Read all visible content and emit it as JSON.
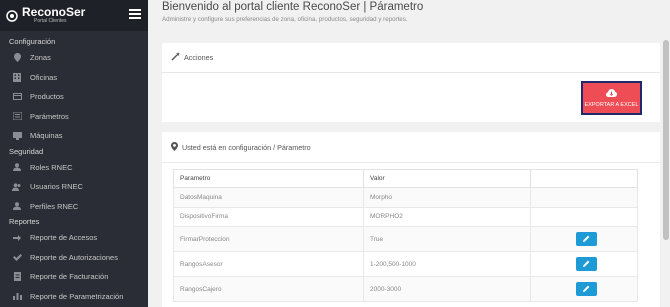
{
  "brand": {
    "name": "ReconoSer",
    "sub": "Portal Clientes"
  },
  "sidebar": {
    "sections": [
      {
        "title": "Configuración",
        "items": [
          {
            "label": "Zonas",
            "icon": "map-marker-icon"
          },
          {
            "label": "Oficinas",
            "icon": "building-icon"
          },
          {
            "label": "Productos",
            "icon": "box-icon"
          },
          {
            "label": "Parámetros",
            "icon": "list-icon"
          },
          {
            "label": "Máquinas",
            "icon": "monitor-icon"
          }
        ]
      },
      {
        "title": "Seguridad",
        "items": [
          {
            "label": "Roles RNEC",
            "icon": "user-icon"
          },
          {
            "label": "Usuarios RNEC",
            "icon": "users-icon"
          },
          {
            "label": "Perfiles RNEC",
            "icon": "user-icon"
          }
        ]
      },
      {
        "title": "Reportes",
        "items": [
          {
            "label": "Reporte de Accesos",
            "icon": "login-icon"
          },
          {
            "label": "Reporte de Autorizaciones",
            "icon": "check-icon"
          },
          {
            "label": "Reporte de Facturación",
            "icon": "invoice-icon"
          },
          {
            "label": "Reporte de Parametrización",
            "icon": "chart-icon"
          }
        ]
      }
    ]
  },
  "header": {
    "title": "Bienvenido al portal cliente ReconoSer | Párametro",
    "subtitle": "Administre y configure sus preferencias de zona, oficina, productos, seguridad y reportes."
  },
  "actions": {
    "title": "Acciones",
    "export_label": "EXPORTAR A EXCEL"
  },
  "location": {
    "text": "Usted está en configuración / Párametro"
  },
  "table": {
    "headers": [
      "Parametro",
      "Valor",
      ""
    ],
    "rows": [
      {
        "param": "DatosMaquina",
        "value": "Morpho",
        "editable": false
      },
      {
        "param": "DispositivoFirma",
        "value": "MORPHO2",
        "editable": false
      },
      {
        "param": "FirmarProteccion",
        "value": "True",
        "editable": true
      },
      {
        "param": "RangosAsesor",
        "value": "1-200,500-1000",
        "editable": true
      },
      {
        "param": "RangosCajero",
        "value": "2000-3000",
        "editable": true
      }
    ]
  },
  "colors": {
    "sidebar": "#2a2d35",
    "accent_red": "#ef4d56",
    "edit_blue": "#1e9bd7"
  }
}
